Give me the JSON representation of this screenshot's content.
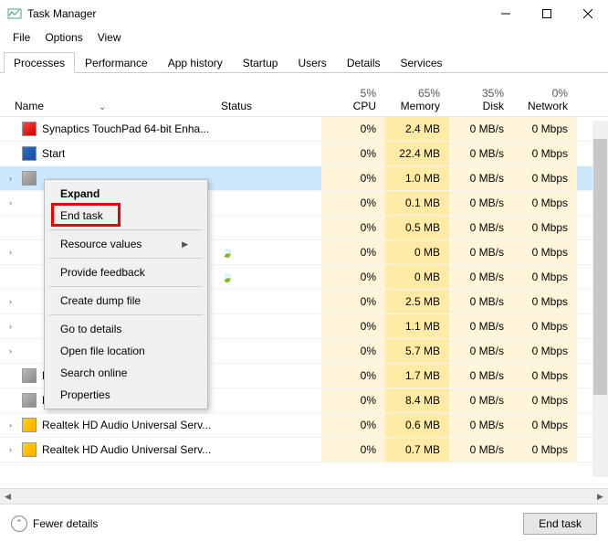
{
  "window": {
    "title": "Task Manager"
  },
  "menu": [
    "File",
    "Options",
    "View"
  ],
  "tabs": [
    "Processes",
    "Performance",
    "App history",
    "Startup",
    "Users",
    "Details",
    "Services"
  ],
  "active_tab": 0,
  "columns": {
    "name": "Name",
    "status": "Status",
    "cpu": {
      "pct": "5%",
      "label": "CPU"
    },
    "memory": {
      "pct": "65%",
      "label": "Memory"
    },
    "disk": {
      "pct": "35%",
      "label": "Disk"
    },
    "network": {
      "pct": "0%",
      "label": "Network"
    }
  },
  "context_menu": {
    "items": [
      "Expand",
      "End task",
      "Resource values",
      "Provide feedback",
      "Create dump file",
      "Go to details",
      "Open file location",
      "Search online",
      "Properties"
    ],
    "submenu_index": 2
  },
  "processes": [
    {
      "expand": false,
      "icon": "iconR",
      "name": "Synaptics TouchPad 64-bit Enha...",
      "status": "",
      "cpu": "0%",
      "mem": "2.4 MB",
      "disk": "0 MB/s",
      "net": "0 Mbps"
    },
    {
      "expand": false,
      "icon": "iconW",
      "name": "Start",
      "status": "",
      "cpu": "0%",
      "mem": "22.4 MB",
      "disk": "0 MB/s",
      "net": "0 Mbps"
    },
    {
      "expand": true,
      "icon": "iconG",
      "name": "",
      "status": "",
      "cpu": "0%",
      "mem": "1.0 MB",
      "disk": "0 MB/s",
      "net": "0 Mbps",
      "selected": true
    },
    {
      "expand": true,
      "icon": "",
      "name": "",
      "status": "",
      "cpu": "0%",
      "mem": "0.1 MB",
      "disk": "0 MB/s",
      "net": "0 Mbps"
    },
    {
      "expand": false,
      "icon": "",
      "name": "",
      "status": "",
      "cpu": "0%",
      "mem": "0.5 MB",
      "disk": "0 MB/s",
      "net": "0 Mbps"
    },
    {
      "expand": true,
      "icon": "",
      "name": "",
      "status": "leaf",
      "cpu": "0%",
      "mem": "0 MB",
      "disk": "0 MB/s",
      "net": "0 Mbps"
    },
    {
      "expand": false,
      "icon": "",
      "name": "",
      "status": "leaf",
      "cpu": "0%",
      "mem": "0 MB",
      "disk": "0 MB/s",
      "net": "0 Mbps"
    },
    {
      "expand": true,
      "icon": "",
      "name": "",
      "status": "",
      "cpu": "0%",
      "mem": "2.5 MB",
      "disk": "0 MB/s",
      "net": "0 Mbps"
    },
    {
      "expand": true,
      "icon": "",
      "name": "",
      "status": "",
      "cpu": "0%",
      "mem": "1.1 MB",
      "disk": "0 MB/s",
      "net": "0 Mbps"
    },
    {
      "expand": true,
      "icon": "",
      "name": "",
      "status": "",
      "cpu": "0%",
      "mem": "5.7 MB",
      "disk": "0 MB/s",
      "net": "0 Mbps"
    },
    {
      "expand": false,
      "icon": "iconG",
      "name": "Runtime Broker",
      "status": "",
      "cpu": "0%",
      "mem": "1.7 MB",
      "disk": "0 MB/s",
      "net": "0 Mbps"
    },
    {
      "expand": false,
      "icon": "iconG",
      "name": "Runtime Broker",
      "status": "",
      "cpu": "0%",
      "mem": "8.4 MB",
      "disk": "0 MB/s",
      "net": "0 Mbps"
    },
    {
      "expand": true,
      "icon": "iconA",
      "name": "Realtek HD Audio Universal Serv...",
      "status": "",
      "cpu": "0%",
      "mem": "0.6 MB",
      "disk": "0 MB/s",
      "net": "0 Mbps"
    },
    {
      "expand": true,
      "icon": "iconA",
      "name": "Realtek HD Audio Universal Serv...",
      "status": "",
      "cpu": "0%",
      "mem": "0.7 MB",
      "disk": "0 MB/s",
      "net": "0 Mbps"
    }
  ],
  "footer": {
    "fewer": "Fewer details",
    "end": "End task"
  }
}
